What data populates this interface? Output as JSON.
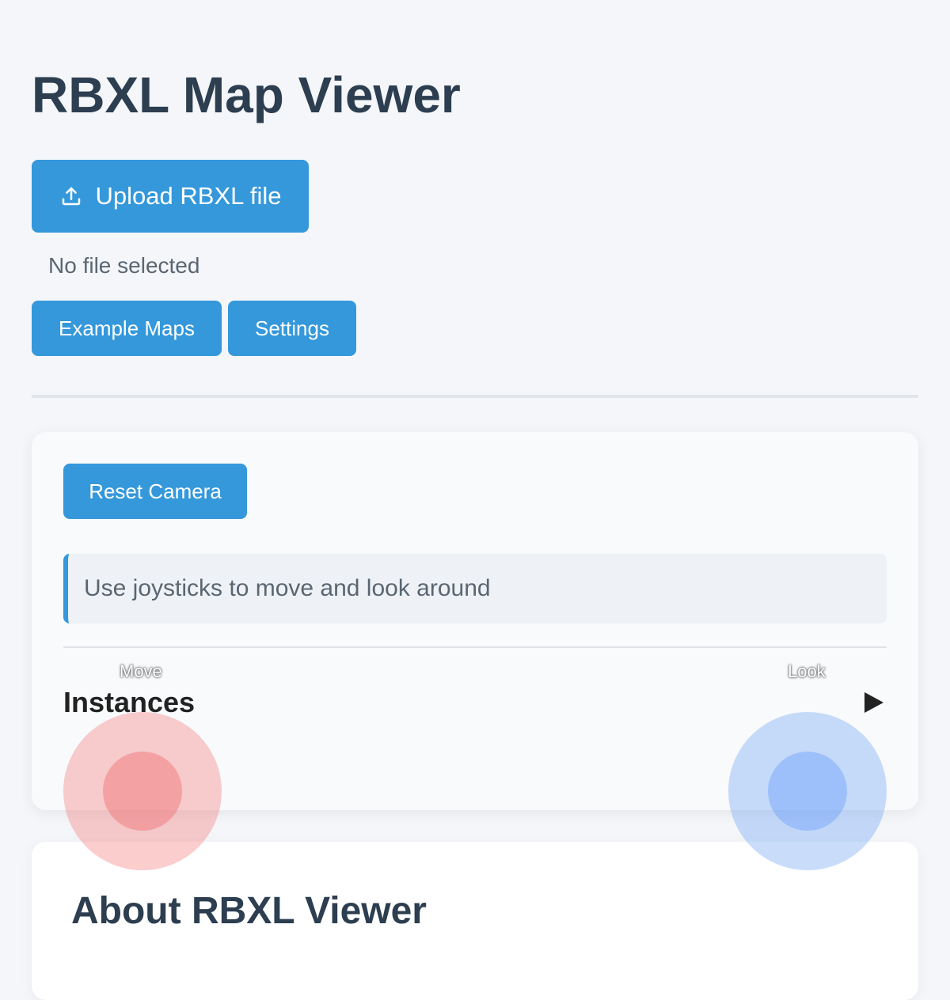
{
  "page": {
    "title": "RBXL Map Viewer"
  },
  "upload": {
    "label": "Upload RBXL file",
    "icon": "upload-icon",
    "status": "No file selected"
  },
  "toolbar": {
    "example_maps_label": "Example Maps",
    "settings_label": "Settings"
  },
  "viewer": {
    "reset_camera_label": "Reset Camera",
    "hint": "Use joysticks to move and look around",
    "instances_title": "Instances",
    "instances_expanded": false
  },
  "joysticks": {
    "move_label": "Move",
    "look_label": "Look"
  },
  "about": {
    "title": "About RBXL Viewer"
  },
  "colors": {
    "accent": "#3498db",
    "heading": "#2c3e50",
    "background": "#f4f6f9",
    "move_joystick": "#f48282",
    "look_joystick": "#78aaf5"
  }
}
